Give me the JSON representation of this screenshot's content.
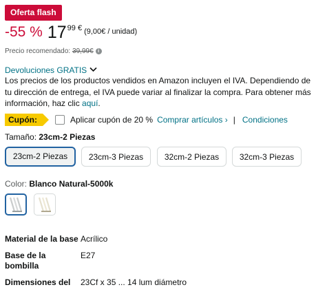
{
  "badge": "Oferta flash",
  "price": {
    "discount": "-55 %",
    "whole": "17",
    "fraction": "99 €",
    "unit_price": "(9,00€ / unidad)",
    "recommended_label": "Precio recomendado:",
    "recommended_value": "39,99€"
  },
  "returns": {
    "label": "Devoluciones GRATIS"
  },
  "vat_notice": {
    "text": "Los precios de los productos vendidos en Amazon incluyen el IVA. Dependiendo de tu dirección de entrega, el IVA puede variar al finalizar la compra. Para obtener más información, haz clic ",
    "link": "aquí",
    "end": "."
  },
  "coupon": {
    "tag": "Cupón:",
    "apply_label": "Aplicar cupón de 20 %",
    "shop_link": "Comprar artículos ›",
    "separator": "|",
    "conditions": "Condiciones"
  },
  "size": {
    "label": "Tamaño:",
    "selected": "23cm-2 Piezas",
    "options": [
      "23cm-2 Piezas",
      "23cm-3 Piezas",
      "32cm-2 Piezas",
      "32cm-3 Piezas"
    ]
  },
  "color": {
    "label": "Color:",
    "selected": "Blanco Natural-5000k"
  },
  "specs": [
    {
      "key": "Material de la base",
      "value": "Acrílico"
    },
    {
      "key": "Base de la bombilla",
      "value": "E27"
    },
    {
      "key": "Dimensiones del",
      "value": "23Cf x 35 ... 14 lum diámetro"
    }
  ],
  "colors": {
    "deal_red": "#cc0c39",
    "link": "#007185",
    "coupon_yellow": "#f7ca00",
    "selected_border": "#2162a1"
  }
}
